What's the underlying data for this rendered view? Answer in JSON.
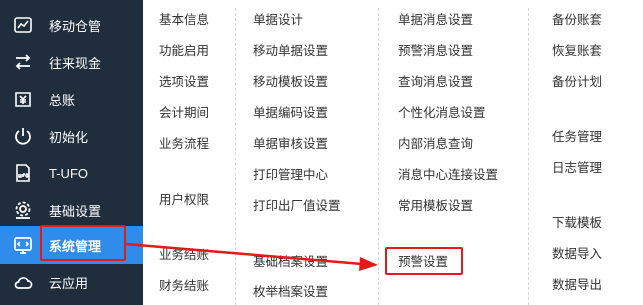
{
  "sidebar": {
    "items": [
      {
        "label": "移动仓管",
        "icon": "warehouse-chart-icon"
      },
      {
        "label": "往来现金",
        "icon": "swap-arrows-icon"
      },
      {
        "label": "总账",
        "icon": "ledger-money-icon"
      },
      {
        "label": "初始化",
        "icon": "power-init-icon"
      },
      {
        "label": "T-UFO",
        "icon": "ufo-file-icon"
      },
      {
        "label": "基础设置",
        "icon": "gear-settings-icon"
      },
      {
        "label": "系统管理",
        "icon": "system-monitor-icon",
        "active": true
      },
      {
        "label": "云应用",
        "icon": "cloud-icon"
      }
    ]
  },
  "menu": {
    "col1": [
      "基本信息",
      "功能启用",
      "选项设置",
      "会计期间",
      "业务流程",
      "用户权限",
      "业务结账",
      "财务结账"
    ],
    "col2": [
      "单据设计",
      "移动单据设置",
      "移动模板设置",
      "单据编码设置",
      "单据审核设置",
      "打印管理中心",
      "打印出厂值设置",
      "基础档案设置",
      "枚举档案设置"
    ],
    "col3": [
      "单据消息设置",
      "预警消息设置",
      "查询消息设置",
      "个性化消息设置",
      "内部消息查询",
      "消息中心连接设置",
      "常用模板设置",
      "预警设置"
    ],
    "col4": [
      "备份账套",
      "恢复账套",
      "备份计划",
      "任务管理",
      "日志管理",
      "下载模板",
      "数据导入",
      "数据导出"
    ]
  },
  "colors": {
    "sidebar_bg": "#1f2d3d",
    "active_bg": "#2f8cea",
    "annotation_red": "#e11a1a",
    "menu_text": "#333333"
  }
}
